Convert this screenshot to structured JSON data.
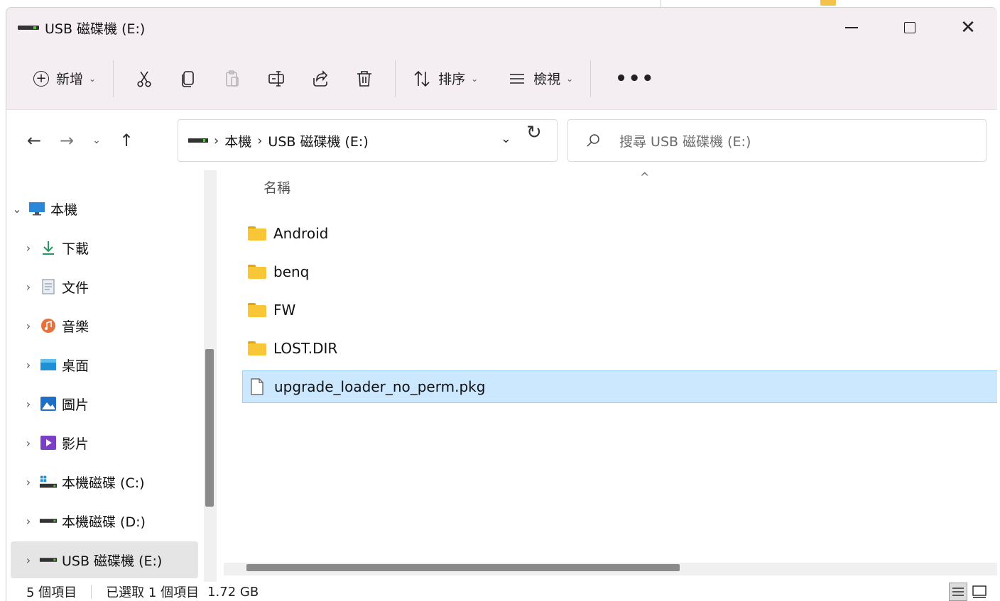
{
  "window": {
    "title": "USB 磁碟機 (E:)"
  },
  "commandbar": {
    "new_label": "新增",
    "sort_label": "排序",
    "view_label": "檢視"
  },
  "address": {
    "breadcrumbs": [
      "本機",
      "USB 磁碟機 (E:)"
    ],
    "search_placeholder": "搜尋 USB 磁碟機 (E:)"
  },
  "navpane": {
    "items": [
      {
        "label": "本機",
        "icon": "computer-icon"
      },
      {
        "label": "下載",
        "icon": "download-icon"
      },
      {
        "label": "文件",
        "icon": "documents-icon"
      },
      {
        "label": "音樂",
        "icon": "music-icon"
      },
      {
        "label": "桌面",
        "icon": "desktop-icon"
      },
      {
        "label": "圖片",
        "icon": "pictures-icon"
      },
      {
        "label": "影片",
        "icon": "videos-icon"
      },
      {
        "label": "本機磁碟 (C:)",
        "icon": "windows-drive-icon"
      },
      {
        "label": "本機磁碟 (D:)",
        "icon": "drive-icon"
      },
      {
        "label": "USB 磁碟機 (E:)",
        "icon": "usb-drive-icon"
      }
    ]
  },
  "content": {
    "column_name": "名稱",
    "files": [
      {
        "name": "Android",
        "type": "folder"
      },
      {
        "name": "benq",
        "type": "folder"
      },
      {
        "name": "FW",
        "type": "folder"
      },
      {
        "name": "LOST.DIR",
        "type": "folder"
      },
      {
        "name": "upgrade_loader_no_perm.pkg",
        "type": "file"
      }
    ]
  },
  "status": {
    "item_count": "5 個項目",
    "selected": "已選取 1 個項目",
    "size": "1.72 GB"
  },
  "colors": {
    "chrome_bg": "#f4eef2",
    "selection_bg": "#cce8ff",
    "folder": "#f8c637"
  }
}
